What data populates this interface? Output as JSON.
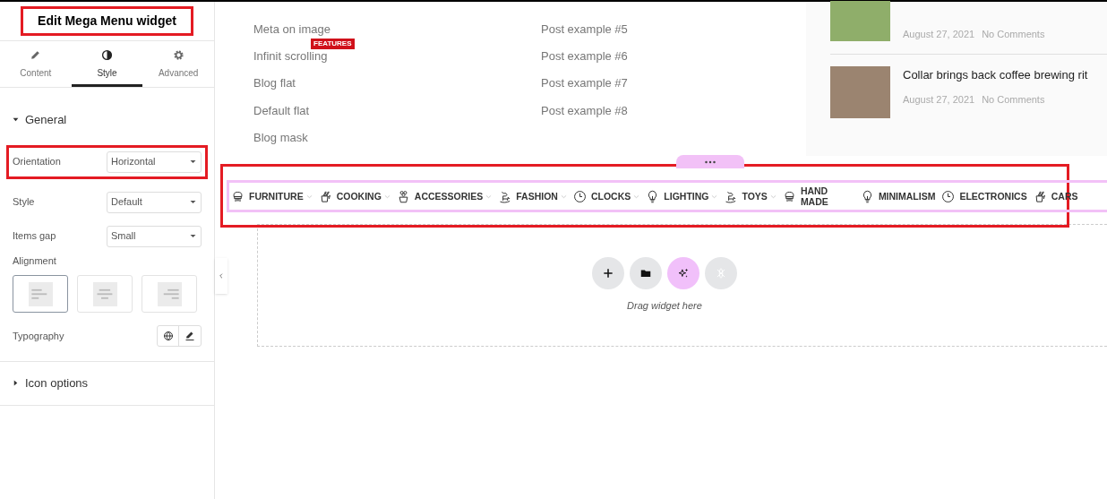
{
  "panel": {
    "title": "Edit Mega Menu widget",
    "tabs": [
      {
        "label": "Content",
        "selected": false
      },
      {
        "label": "Style",
        "selected": true
      },
      {
        "label": "Advanced",
        "selected": false
      }
    ],
    "sections": [
      {
        "title": "General",
        "expanded": true,
        "controls": [
          {
            "kind": "select",
            "label": "Orientation",
            "value": "Horizontal",
            "highlighted": true
          },
          {
            "kind": "select",
            "label": "Style",
            "value": "Default",
            "highlighted": false
          },
          {
            "kind": "select",
            "label": "Items gap",
            "value": "Small",
            "highlighted": false
          },
          {
            "kind": "alignment",
            "label": "Alignment",
            "options": [
              {
                "selected": true
              },
              {
                "selected": false
              },
              {
                "selected": false
              }
            ]
          },
          {
            "kind": "typography",
            "label": "Typography"
          }
        ]
      },
      {
        "title": "Icon options",
        "expanded": false
      }
    ]
  },
  "canvas": {
    "links": [
      {
        "left": "Meta on image",
        "right": "Post example #5"
      },
      {
        "left": "Infinit scrolling",
        "right": "Post example #6",
        "badge": "FEATURES"
      },
      {
        "left": "Blog flat",
        "right": "Post example #7"
      },
      {
        "left": "Default flat",
        "right": "Post example #8"
      },
      {
        "left": "Blog mask"
      }
    ],
    "posts": [
      {
        "date": "August 27, 2021",
        "comments": "No Comments"
      },
      {
        "title": "Collar brings back coffee brewing rit",
        "date": "August 27, 2021",
        "comments": "No Comments"
      }
    ],
    "menu": [
      {
        "label": "FURNITURE",
        "kind": "chair",
        "dropdown": true
      },
      {
        "label": "COOKING",
        "kind": "knives",
        "dropdown": true
      },
      {
        "label": "ACCESSORIES",
        "kind": "plant",
        "dropdown": true
      },
      {
        "label": "FASHION",
        "kind": "horse",
        "dropdown": true
      },
      {
        "label": "CLOCKS",
        "kind": "clock",
        "dropdown": true
      },
      {
        "label": "LIGHTING",
        "kind": "bulb",
        "dropdown": true
      },
      {
        "label": "TOYS",
        "kind": "horse",
        "dropdown": true
      },
      {
        "label": "HAND MADE",
        "kind": "chair",
        "dropdown": false
      },
      {
        "label": "MINIMALISM",
        "kind": "bulb",
        "dropdown": false
      },
      {
        "label": "ELECTRONICS",
        "kind": "clock",
        "dropdown": false
      },
      {
        "label": "CARS",
        "kind": "knives",
        "dropdown": false
      }
    ],
    "dropzone": {
      "hint": "Drag widget here"
    }
  }
}
